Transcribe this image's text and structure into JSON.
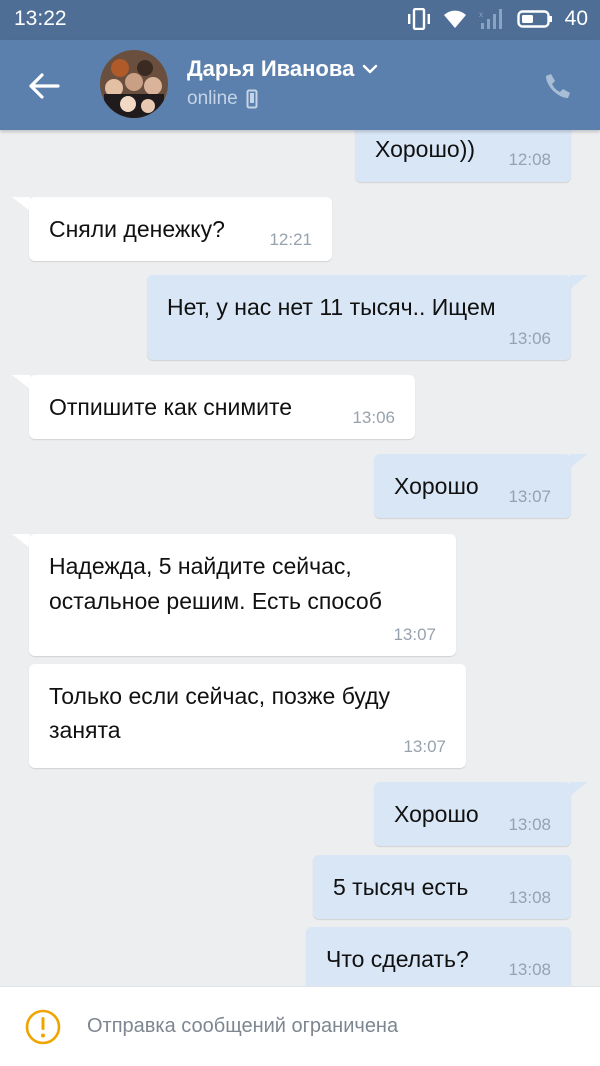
{
  "status_bar": {
    "time": "13:22",
    "battery": "40"
  },
  "header": {
    "contact_name": "Дарья Иванова",
    "status": "online"
  },
  "messages": [
    {
      "text": "Хорошо))",
      "time": "12:08"
    },
    {
      "text": "Сняли денежку?",
      "time": "12:21"
    },
    {
      "text": "Нет, у нас нет 11 тысяч.. Ищем",
      "time": "13:06"
    },
    {
      "text": "Отпишите как снимите",
      "time": "13:06"
    },
    {
      "text": "Хорошо",
      "time": "13:07"
    },
    {
      "line1": "Надежда, 5 найдите сейчас,",
      "line2": "остальное решим. Есть способ",
      "time": "13:07"
    },
    {
      "line1": "Только если сейчас, позже буду",
      "line2": "занята",
      "time": "13:07"
    },
    {
      "text": "Хорошо",
      "time": "13:08"
    },
    {
      "text": "5 тысяч есть",
      "time": "13:08"
    },
    {
      "text": "Что сделать?",
      "time": "13:08"
    }
  ],
  "footer": {
    "text": "Отправка сообщений ограничена"
  },
  "colors": {
    "header": "#5b80ad",
    "status_bar": "#4e6e96",
    "outgoing_bubble": "#d9e6f6",
    "incoming_bubble": "#ffffff",
    "background": "#edeef0",
    "warning": "#f0a400"
  }
}
